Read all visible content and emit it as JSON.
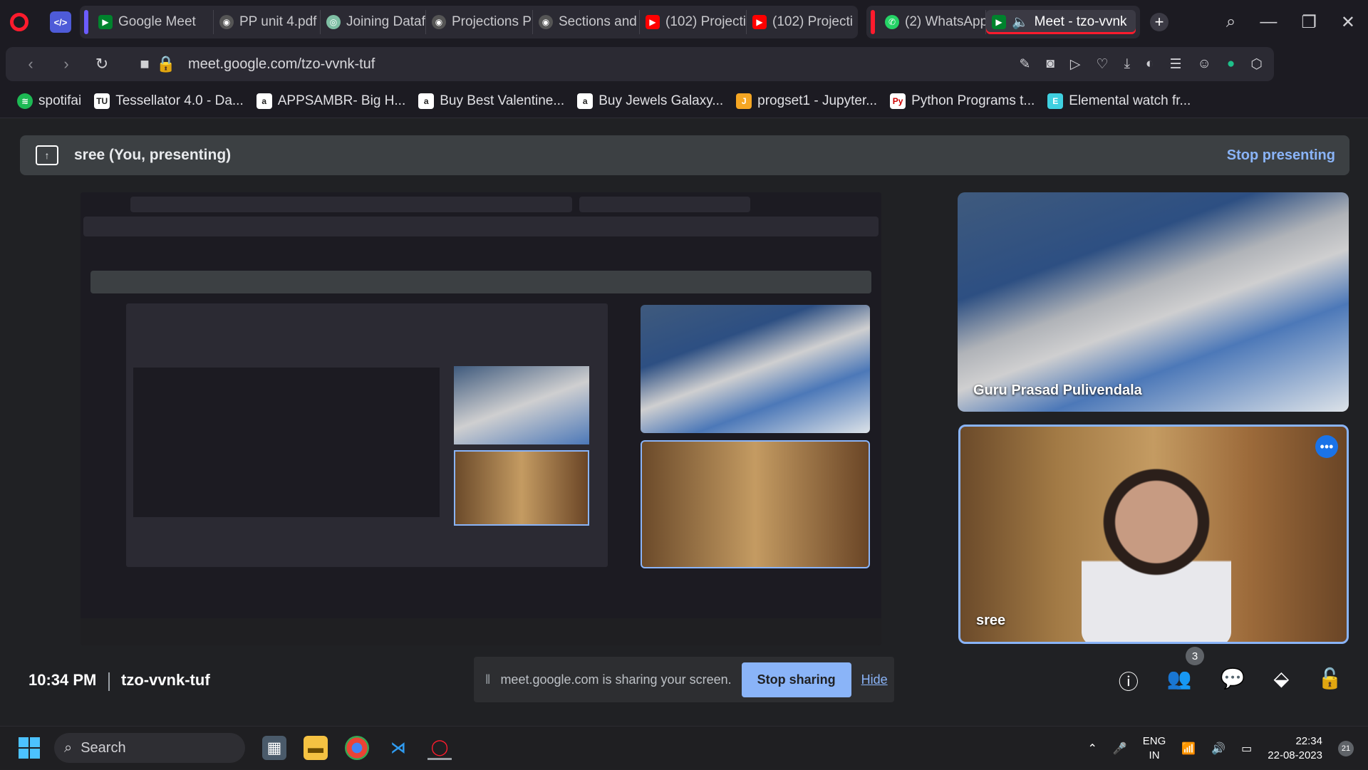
{
  "browser": {
    "tabs": [
      {
        "label": "Google Meet",
        "icon": "google-meet-icon"
      },
      {
        "label": "PP unit 4.pdf",
        "icon": "globe-icon"
      },
      {
        "label": "Joining Dataf",
        "icon": "joining-icon"
      },
      {
        "label": "Projections P",
        "icon": "globe-icon"
      },
      {
        "label": "Sections and",
        "icon": "globe-icon"
      },
      {
        "label": "(102) Projecti",
        "icon": "youtube-icon"
      },
      {
        "label": "(102) Projecti",
        "icon": "youtube-icon"
      }
    ],
    "tabs2": [
      {
        "label": "(2) WhatsApp",
        "icon": "whatsapp-icon"
      },
      {
        "label": "Meet - tzo-vvnk",
        "icon": "google-meet-icon"
      }
    ],
    "url": "meet.google.com/tzo-vvnk-tuf",
    "bookmarks": [
      "spotifai",
      "Tessellator 4.0 - Da...",
      "APPSAMBR- Big H...",
      "Buy Best Valentine...",
      "Buy Jewels Galaxy...",
      "progset1 - Jupyter...",
      "Python Programs t...",
      "Elemental watch fr..."
    ]
  },
  "meet": {
    "presenting_label": "sree (You, presenting)",
    "stop_presenting": "Stop presenting",
    "participants": [
      {
        "name": "Guru Prasad Pulivendala"
      },
      {
        "name": "sree"
      }
    ],
    "time": "10:34 PM",
    "meeting_code": "tzo-vvnk-tuf",
    "share_text": "meet.google.com is sharing your screen.",
    "stop_sharing": "Stop sharing",
    "hide": "Hide",
    "people_count": "3",
    "more_dots": "•••"
  },
  "taskbar": {
    "search": "Search",
    "lang_line1": "ENG",
    "lang_line2": "IN",
    "time": "22:34",
    "date": "22-08-2023",
    "notifications": "21"
  }
}
